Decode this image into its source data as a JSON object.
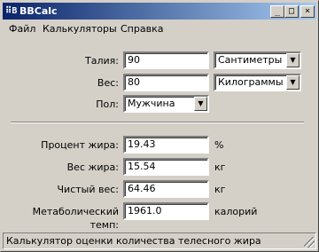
{
  "window": {
    "title": "BBCalc",
    "icon": "app-icon",
    "app_icon_glyph": "⠿B"
  },
  "titlebar_buttons": {
    "minimize": "_",
    "maximize": "□",
    "close": "×"
  },
  "menu": [
    {
      "label": "Файл"
    },
    {
      "label": "Калькуляторы"
    },
    {
      "label": "Справка"
    }
  ],
  "inputs": {
    "waist": {
      "label": "Талия:",
      "value": "90",
      "unit": "Сантиметры"
    },
    "weight": {
      "label": "Вес:",
      "value": "80",
      "unit": "Килограммы"
    },
    "gender": {
      "label": "Пол:",
      "value": "Мужчина"
    }
  },
  "results": {
    "fat_percent": {
      "label": "Процент жира:",
      "value": "19.43",
      "unit": "%"
    },
    "fat_weight": {
      "label": "Вес жира:",
      "value": "15.54",
      "unit": "кг"
    },
    "lean_weight": {
      "label": "Чистый вес:",
      "value": "64.46",
      "unit": "кг"
    },
    "metabolic": {
      "label": "Метаболический темп:",
      "value": "1961.0",
      "unit": "калорий"
    }
  },
  "status": "Калькулятор оценки количества телесного жира",
  "colors": {
    "titlebar_start": "#0a246a",
    "titlebar_end": "#a6caf0",
    "face": "#d4d0c8"
  }
}
